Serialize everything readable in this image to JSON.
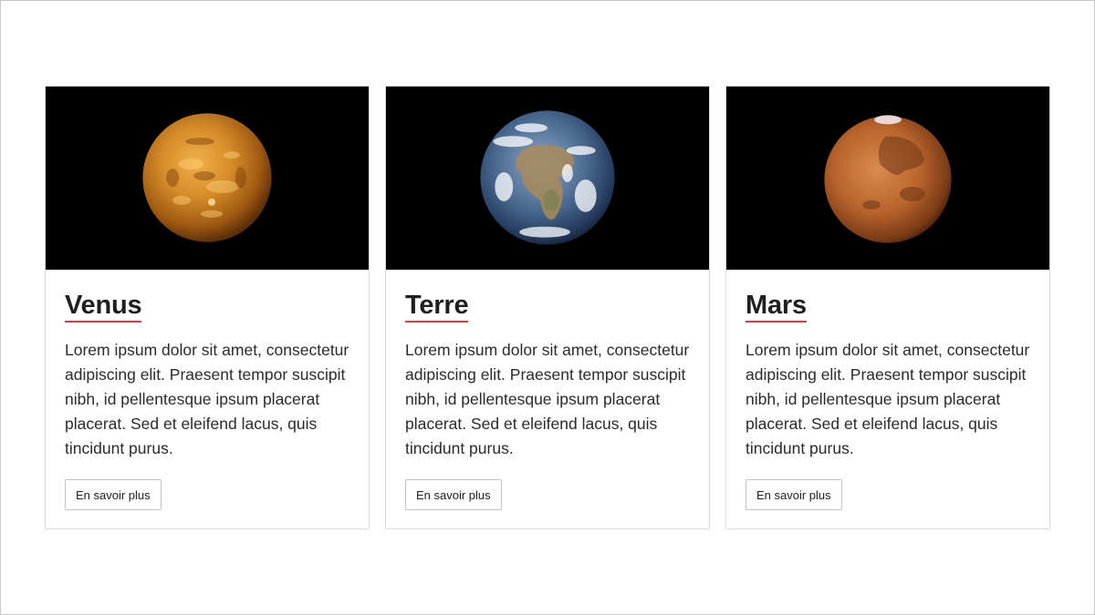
{
  "cards": [
    {
      "title": "Venus",
      "image_icon": "venus-planet-icon",
      "text": "Lorem ipsum dolor sit amet, consectetur adipiscing elit. Praesent tempor suscipit nibh, id pellentesque ipsum placerat placerat. Sed et eleifend lacus, quis tincidunt purus.",
      "button_label": "En savoir plus"
    },
    {
      "title": "Terre",
      "image_icon": "earth-planet-icon",
      "text": "Lorem ipsum dolor sit amet, consectetur adipiscing elit. Praesent tempor suscipit nibh, id pellentesque ipsum placerat placerat. Sed et eleifend lacus, quis tincidunt purus.",
      "button_label": "En savoir plus"
    },
    {
      "title": "Mars",
      "image_icon": "mars-planet-icon",
      "text": "Lorem ipsum dolor sit amet, consectetur adipiscing elit. Praesent tempor suscipit nibh, id pellentesque ipsum placerat placerat. Sed et eleifend lacus, quis tincidunt purus.",
      "button_label": "En savoir plus"
    }
  ],
  "colors": {
    "title_underline": "#e0383e",
    "media_background": "#000000",
    "card_border": "#dadada"
  }
}
